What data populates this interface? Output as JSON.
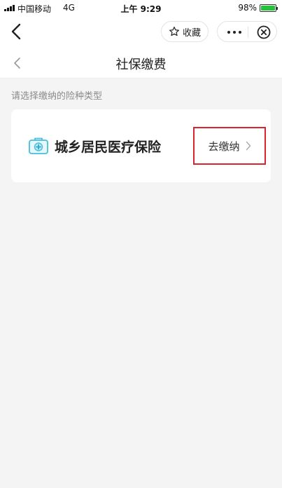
{
  "status_bar": {
    "carrier": "中国移动",
    "network": "4G",
    "time": "上午 9:29",
    "battery_percent": "98%",
    "battery_level": 0.98,
    "battery_color": "#27c23c"
  },
  "nav": {
    "favorite_label": "收藏",
    "icons": [
      "chevron-left-icon",
      "star-icon",
      "more-icon",
      "close-circle-icon"
    ]
  },
  "page": {
    "title": "社保缴费",
    "section_hint": "请选择缴纳的险种类型"
  },
  "insurance_items": [
    {
      "name": "城乡居民医疗保险",
      "action_label": "去缴纳",
      "icon": "medical-kit-icon",
      "highlight_color": "#d9232d"
    }
  ]
}
